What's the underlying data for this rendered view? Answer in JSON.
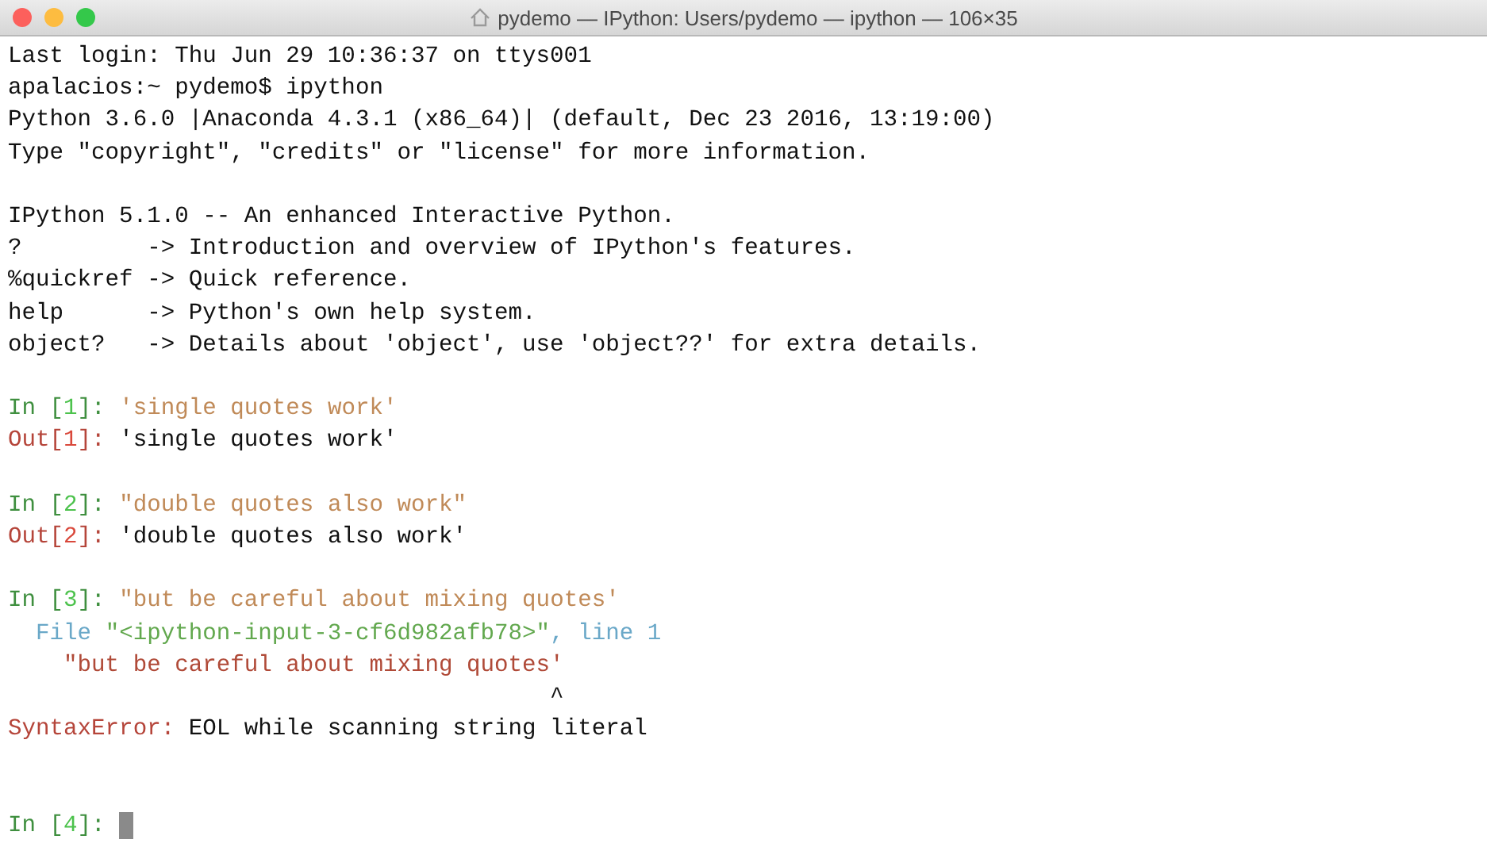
{
  "window": {
    "title": "pydemo — IPython: Users/pydemo — ipython — 106×35"
  },
  "blocks": [
    {
      "kind": "output",
      "lines": [
        [
          {
            "kind": "plain",
            "text": "Last login: Thu Jun 29 10:36:37 on ttys001"
          }
        ],
        [
          {
            "kind": "plain",
            "text": "apalacios:~ pydemo$ ipython"
          }
        ],
        [
          {
            "kind": "plain",
            "text": "Python 3.6.0 |Anaconda 4.3.1 (x86_64)| (default, Dec 23 2016, 13:19:00)"
          }
        ],
        [
          {
            "kind": "plain",
            "text": "Type \"copyright\", \"credits\" or \"license\" for more information."
          }
        ]
      ]
    },
    {
      "kind": "output",
      "lines": [
        [
          {
            "kind": "plain",
            "text": "IPython 5.1.0 -- An enhanced Interactive Python."
          }
        ],
        [
          {
            "kind": "plain",
            "text": "?         -> Introduction and overview of IPython's features."
          }
        ],
        [
          {
            "kind": "plain",
            "text": "%quickref -> Quick reference."
          }
        ],
        [
          {
            "kind": "plain",
            "text": "help      -> Python's own help system."
          }
        ],
        [
          {
            "kind": "plain",
            "text": "object?   -> Details about 'object', use 'object??' for extra details."
          }
        ]
      ]
    },
    {
      "kind": "output",
      "lines": [
        [
          {
            "kind": "in",
            "text": "In ["
          },
          {
            "kind": "in-num",
            "text": "1"
          },
          {
            "kind": "in",
            "text": "]: "
          },
          {
            "kind": "string",
            "text": "'single quotes work'"
          }
        ],
        [
          {
            "kind": "out",
            "text": "Out["
          },
          {
            "kind": "out-num",
            "text": "1"
          },
          {
            "kind": "out",
            "text": "]: "
          },
          {
            "kind": "plain",
            "text": "'single quotes work'"
          }
        ]
      ]
    },
    {
      "kind": "output",
      "lines": [
        [
          {
            "kind": "in",
            "text": "In ["
          },
          {
            "kind": "in-num",
            "text": "2"
          },
          {
            "kind": "in",
            "text": "]: "
          },
          {
            "kind": "string",
            "text": "\"double quotes also work\""
          }
        ],
        [
          {
            "kind": "out",
            "text": "Out["
          },
          {
            "kind": "out-num",
            "text": "2"
          },
          {
            "kind": "out",
            "text": "]: "
          },
          {
            "kind": "plain",
            "text": "'double quotes also work'"
          }
        ]
      ]
    },
    {
      "kind": "output",
      "lines": [
        [
          {
            "kind": "in",
            "text": "In ["
          },
          {
            "kind": "in-num",
            "text": "3"
          },
          {
            "kind": "in",
            "text": "]: "
          },
          {
            "kind": "string",
            "text": "\"but be careful about mixing quotes'"
          }
        ],
        [
          {
            "kind": "file",
            "text": "  File "
          },
          {
            "kind": "filename",
            "text": "\"<ipython-input-3-cf6d982afb78>\""
          },
          {
            "kind": "file",
            "text": ", line 1"
          }
        ],
        [
          {
            "kind": "error-string",
            "text": "    \"but be careful about mixing quotes'"
          }
        ],
        [
          {
            "kind": "plain",
            "text": "                                       ^"
          }
        ],
        [
          {
            "kind": "error",
            "text": "SyntaxError"
          },
          {
            "kind": "out",
            "text": ": "
          },
          {
            "kind": "plain",
            "text": "EOL while scanning string literal"
          }
        ]
      ]
    },
    {
      "kind": "current",
      "lines": [
        [
          {
            "kind": "in",
            "text": "In ["
          },
          {
            "kind": "in-num",
            "text": "4"
          },
          {
            "kind": "in",
            "text": "]: "
          }
        ]
      ]
    }
  ]
}
